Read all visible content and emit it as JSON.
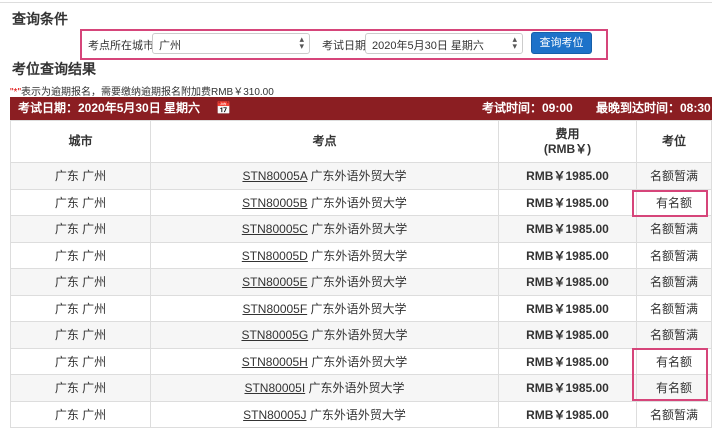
{
  "query": {
    "title": "查询条件",
    "city_label": "考点所在城市",
    "city_value": "广州",
    "date_label": "考试日期",
    "date_value": "2020年5月30日 星期六",
    "search_button": "查询考位"
  },
  "results": {
    "title": "考位查询结果",
    "note_star": "\"*\"",
    "note_text": "表示为逾期报名，需要缴纳逾期报名附加费RMB￥310.00"
  },
  "bar": {
    "exam_date": "考试日期：2020年5月30日 星期六",
    "exam_time": "考试时间：09:00",
    "latest_arrival": "最晚到达时间：08:30"
  },
  "table": {
    "headers": [
      "城市",
      "考点",
      "费用",
      "(RMB￥)",
      "考位"
    ],
    "rows": [
      {
        "city": "广东 广州",
        "code": "STN80005A",
        "name": "广东外语外贸大学",
        "fee": "RMB￥1985.00",
        "seat": "名额暂满"
      },
      {
        "city": "广东 广州",
        "code": "STN80005B",
        "name": "广东外语外贸大学",
        "fee": "RMB￥1985.00",
        "seat": "有名额"
      },
      {
        "city": "广东 广州",
        "code": "STN80005C",
        "name": "广东外语外贸大学",
        "fee": "RMB￥1985.00",
        "seat": "名额暂满"
      },
      {
        "city": "广东 广州",
        "code": "STN80005D",
        "name": "广东外语外贸大学",
        "fee": "RMB￥1985.00",
        "seat": "名额暂满"
      },
      {
        "city": "广东 广州",
        "code": "STN80005E",
        "name": "广东外语外贸大学",
        "fee": "RMB￥1985.00",
        "seat": "名额暂满"
      },
      {
        "city": "广东 广州",
        "code": "STN80005F",
        "name": "广东外语外贸大学",
        "fee": "RMB￥1985.00",
        "seat": "名额暂满"
      },
      {
        "city": "广东 广州",
        "code": "STN80005G",
        "name": "广东外语外贸大学",
        "fee": "RMB￥1985.00",
        "seat": "名额暂满"
      },
      {
        "city": "广东 广州",
        "code": "STN80005H",
        "name": "广东外语外贸大学",
        "fee": "RMB￥1985.00",
        "seat": "有名额"
      },
      {
        "city": "广东 广州",
        "code": "STN80005I",
        "name": "广东外语外贸大学",
        "fee": "RMB￥1985.00",
        "seat": "有名额"
      },
      {
        "city": "广东 广州",
        "code": "STN80005J",
        "name": "广东外语外贸大学",
        "fee": "RMB￥1985.00",
        "seat": "名额暂满"
      }
    ]
  }
}
